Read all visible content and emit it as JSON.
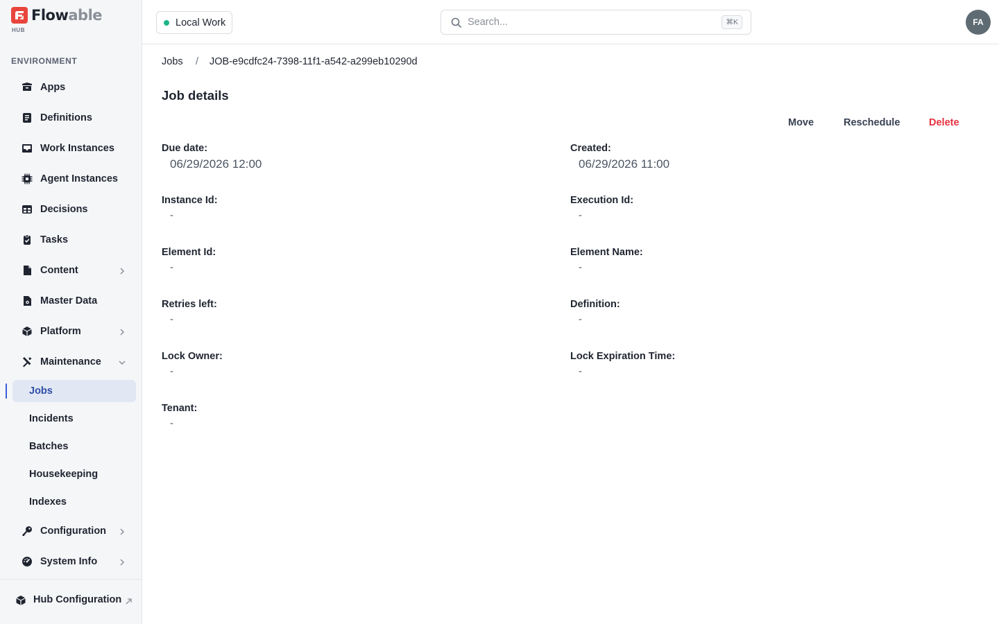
{
  "brand": {
    "name_a": "Flow",
    "name_b": "able",
    "sub": "HUB"
  },
  "sidebar": {
    "section_label": "ENVIRONMENT",
    "items": [
      {
        "label": "Apps",
        "icon": "box-icon"
      },
      {
        "label": "Definitions",
        "icon": "document-icon"
      },
      {
        "label": "Work Instances",
        "icon": "inbox-icon"
      },
      {
        "label": "Agent Instances",
        "icon": "chip-icon"
      },
      {
        "label": "Decisions",
        "icon": "table-icon"
      },
      {
        "label": "Tasks",
        "icon": "clipboard-icon"
      },
      {
        "label": "Content",
        "icon": "file-icon",
        "expandable": true
      },
      {
        "label": "Master Data",
        "icon": "data-file-icon"
      },
      {
        "label": "Platform",
        "icon": "cube-icon",
        "expandable": true
      },
      {
        "label": "Maintenance",
        "icon": "tools-icon",
        "expanded": true
      }
    ],
    "maintenance_children": [
      {
        "label": "Jobs",
        "active": true
      },
      {
        "label": "Incidents"
      },
      {
        "label": "Batches"
      },
      {
        "label": "Housekeeping"
      },
      {
        "label": "Indexes"
      }
    ],
    "after_items": [
      {
        "label": "Configuration",
        "icon": "key-icon",
        "expandable": true
      },
      {
        "label": "System Info",
        "icon": "gauge-icon",
        "expandable": true
      }
    ],
    "footer": {
      "label": "Hub Configuration",
      "icon": "cube-icon"
    }
  },
  "topbar": {
    "environment": "Local Work",
    "search_placeholder": "Search...",
    "search_shortcut": "⌘K",
    "avatar_initials": "FA"
  },
  "breadcrumb": {
    "parent": "Jobs",
    "separator": "/",
    "current": "JOB-e9cdfc24-7398-11f1-a542-a299eb10290d"
  },
  "page": {
    "title": "Job details",
    "actions": {
      "move": "Move",
      "reschedule": "Reschedule",
      "delete": "Delete"
    }
  },
  "fields": {
    "due_date": {
      "label": "Due date:",
      "value": "06/29/2026 12:00"
    },
    "created": {
      "label": "Created:",
      "value": "06/29/2026 11:00"
    },
    "instance_id": {
      "label": "Instance Id:",
      "value": "-"
    },
    "execution_id": {
      "label": "Execution Id:",
      "value": "-"
    },
    "element_id": {
      "label": "Element Id:",
      "value": "-"
    },
    "element_name": {
      "label": "Element Name:",
      "value": "-"
    },
    "retries_left": {
      "label": "Retries left:",
      "value": "-"
    },
    "definition": {
      "label": "Definition:",
      "value": "-"
    },
    "lock_owner": {
      "label": "Lock Owner:",
      "value": "-"
    },
    "lock_expiration": {
      "label": "Lock Expiration Time:",
      "value": "-"
    },
    "tenant": {
      "label": "Tenant:",
      "value": "-"
    }
  },
  "colors": {
    "accent": "#3b5bdb",
    "danger": "#e5303f",
    "status_ok": "#1cb589",
    "brand": "#e8453c"
  }
}
